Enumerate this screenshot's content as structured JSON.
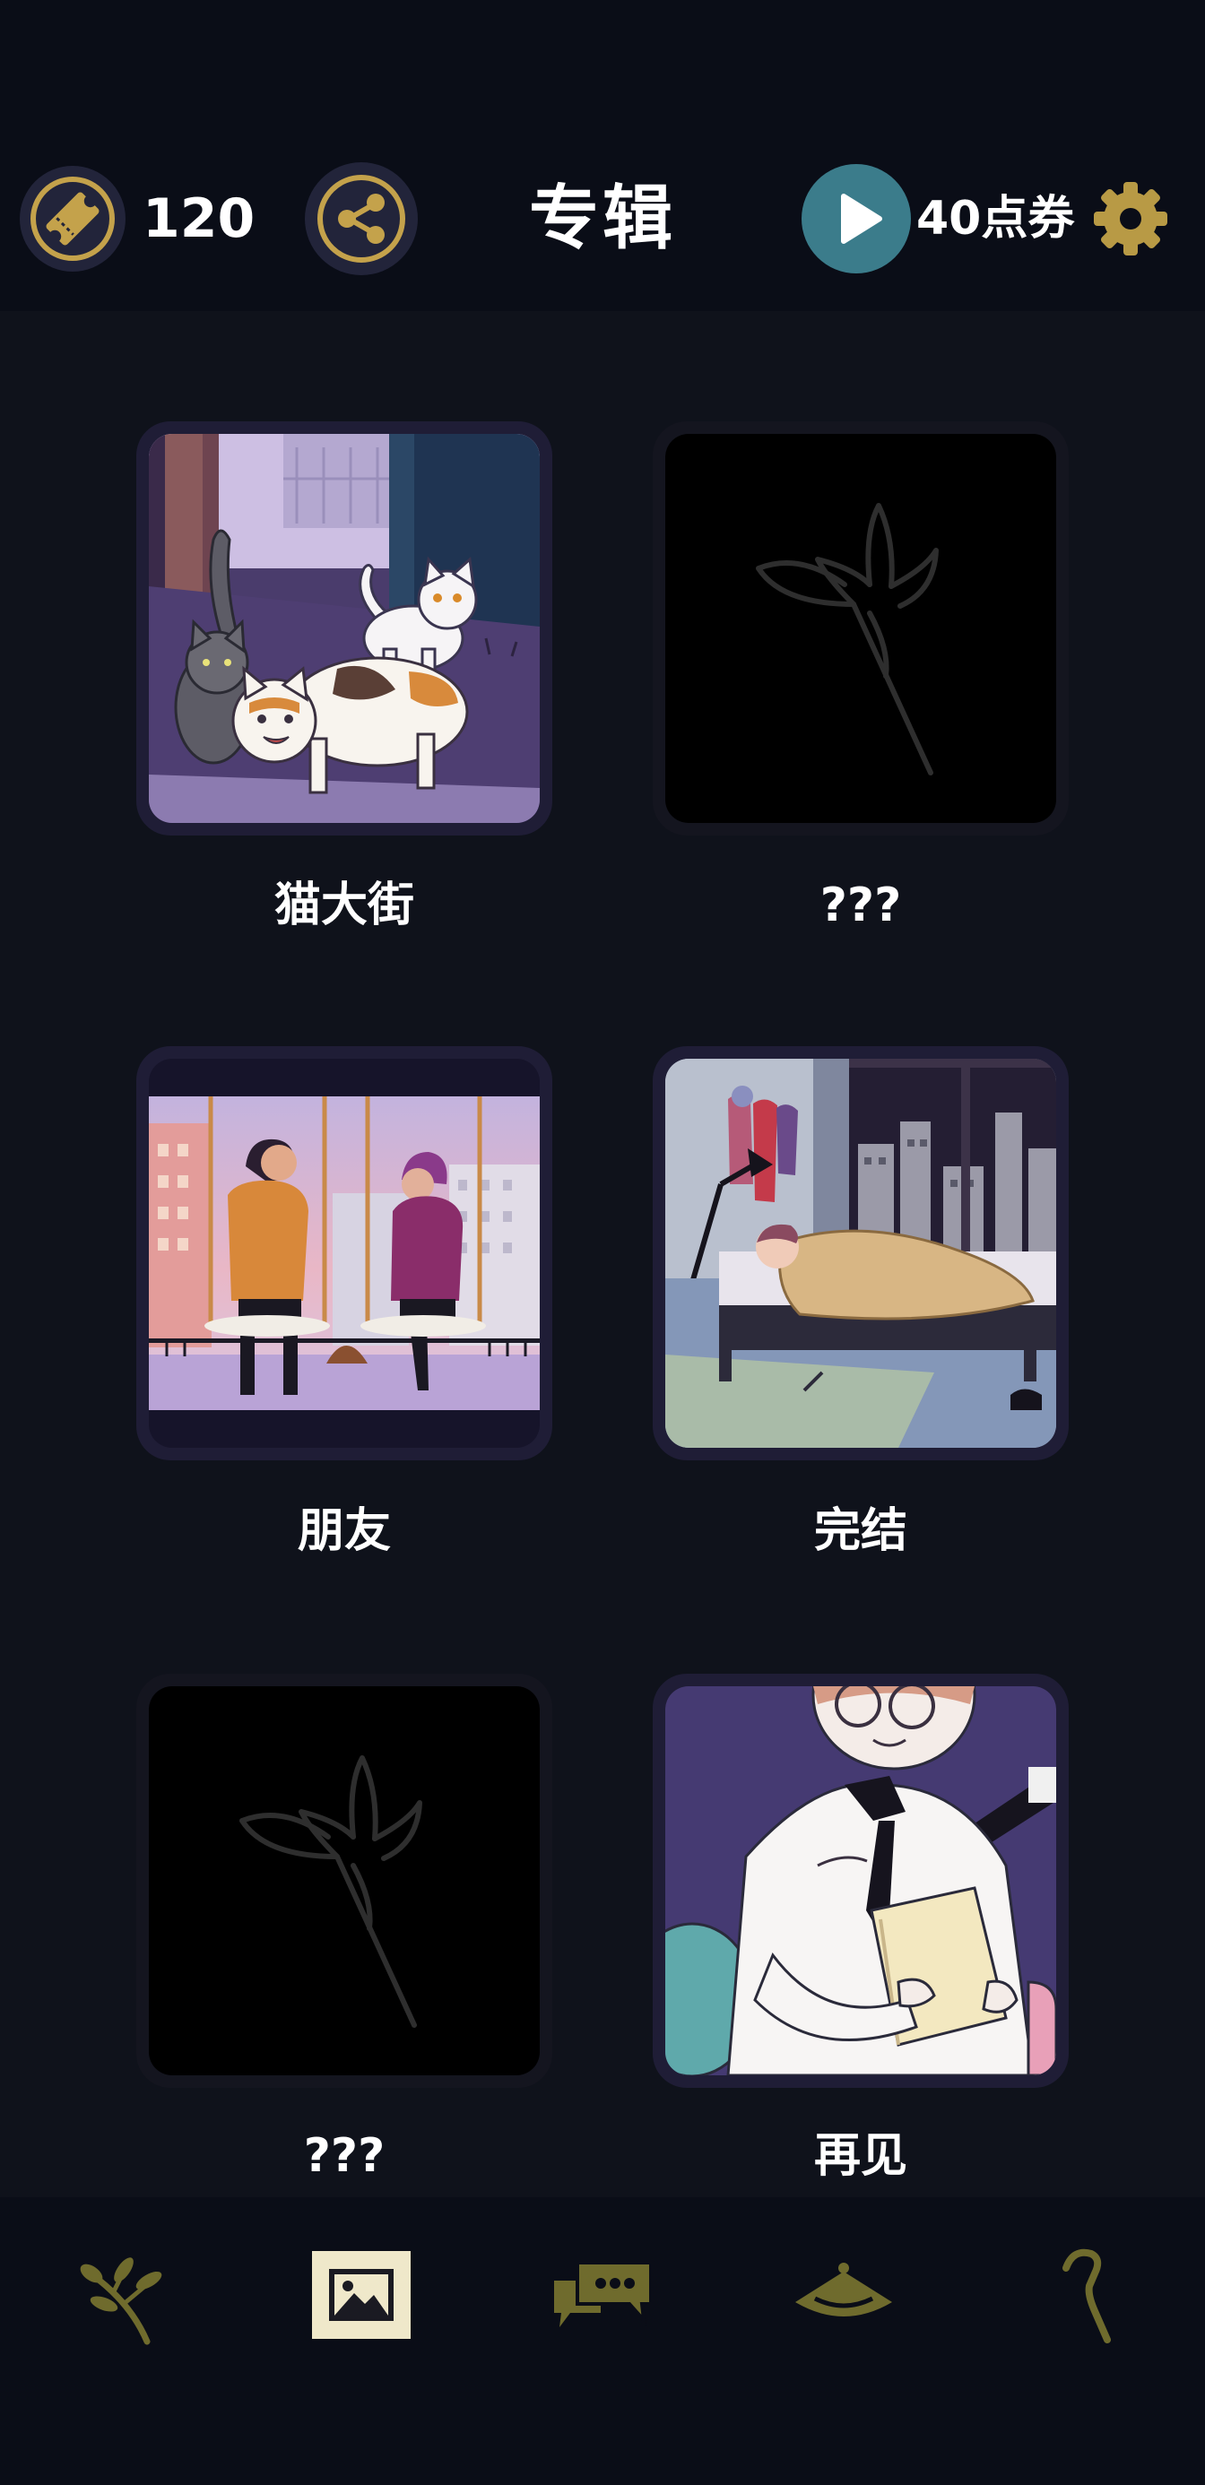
{
  "header": {
    "tickets": "120",
    "title": "专辑",
    "points": "40点券",
    "icons": [
      "ticket-icon",
      "share-icon",
      "play-icon",
      "gear-icon"
    ]
  },
  "albums": [
    {
      "title": "猫大街",
      "locked": false
    },
    {
      "title": "???",
      "locked": true
    },
    {
      "title": "朋友",
      "locked": false
    },
    {
      "title": "完结",
      "locked": false
    },
    {
      "title": "???",
      "locked": true
    },
    {
      "title": "再见",
      "locked": false
    }
  ],
  "nav": [
    {
      "icon": "sprig-icon",
      "active": false
    },
    {
      "icon": "gallery-icon",
      "active": true
    },
    {
      "icon": "chat-icon",
      "active": false
    },
    {
      "icon": "hat-icon",
      "active": false
    },
    {
      "icon": "cane-icon",
      "active": false
    }
  ],
  "colors": {
    "accent_gold": "#c4a24b",
    "nav_icon": "#6f6b2d",
    "active_tab_bg": "#efe8ca",
    "play_button": "#3b7c8b",
    "header_bg": "#0a0d17",
    "content_bg": "#0f121b"
  }
}
